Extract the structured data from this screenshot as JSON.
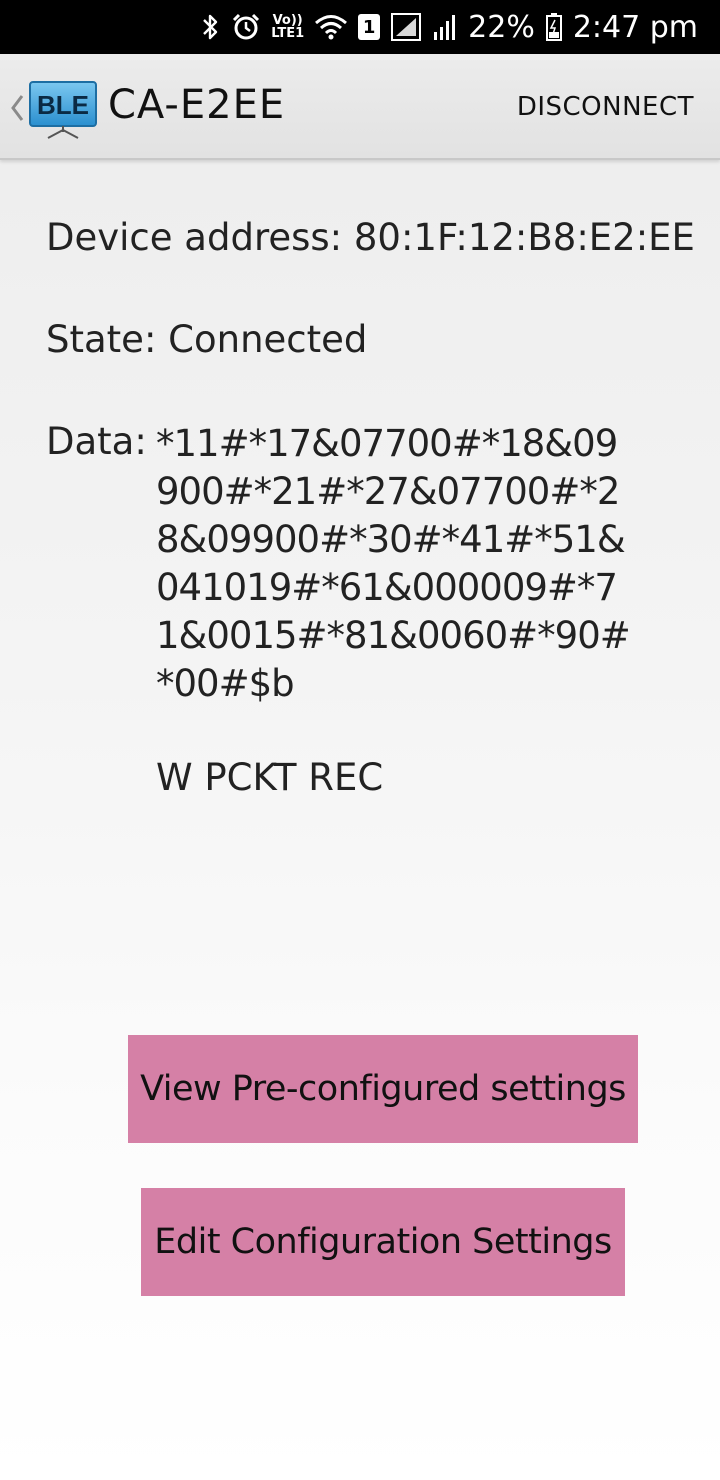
{
  "status_bar": {
    "volte_top": "Vo))",
    "volte_bottom": "LTE1",
    "sim_slot": "1",
    "battery_percent": "22%",
    "time": "2:47 pm",
    "icons": [
      "bluetooth-icon",
      "alarm-icon",
      "volte-icon",
      "wifi-icon",
      "sim-icon",
      "signal-icon",
      "signal-icon",
      "battery-icon"
    ]
  },
  "action_bar": {
    "logo_text": "BLE",
    "title": "CA-E2EE",
    "disconnect_label": "DISCONNECT"
  },
  "device": {
    "address_text": "Device address: 80:1F:12:B8:E2:EE",
    "state_text": "State: Connected",
    "data_label": "Data:",
    "data_lines": [
      "*11#*17&07700#*18&09",
      "900#*21#*27&07700#*2",
      "8&09900#*30#*41#*51&",
      "041019#*61&000009#*7",
      "1&0015#*81&0060#*90#",
      "*00#$b"
    ],
    "status_message": "W PCKT REC"
  },
  "buttons": {
    "view_label": "View Pre-configured settings",
    "edit_label": "Edit Configuration Settings",
    "color": "#d580a6"
  },
  "colors": {
    "status_bar": "#000000",
    "action_bar": "#e6e6e6",
    "text": "#222222",
    "logo_blue": "#3fa9e0"
  }
}
